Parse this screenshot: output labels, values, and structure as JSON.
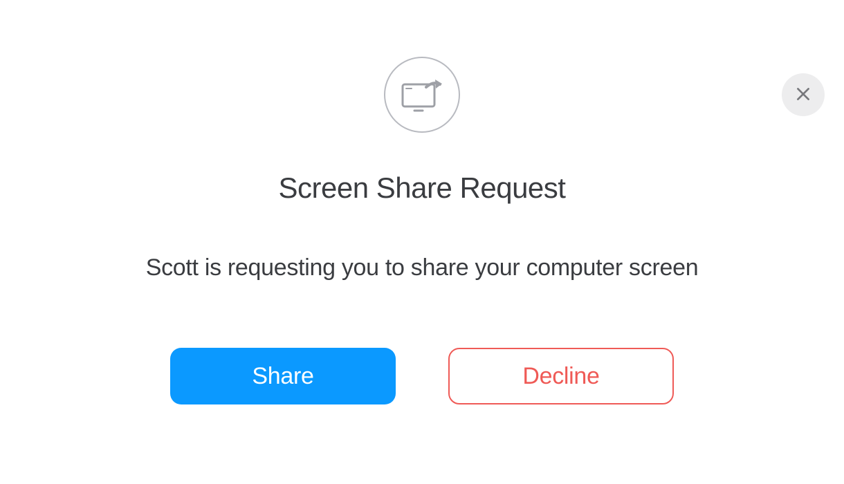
{
  "dialog": {
    "title": "Screen Share Request",
    "message": "Scott is requesting you to share your computer screen",
    "buttons": {
      "primary": "Share",
      "secondary": "Decline"
    }
  }
}
